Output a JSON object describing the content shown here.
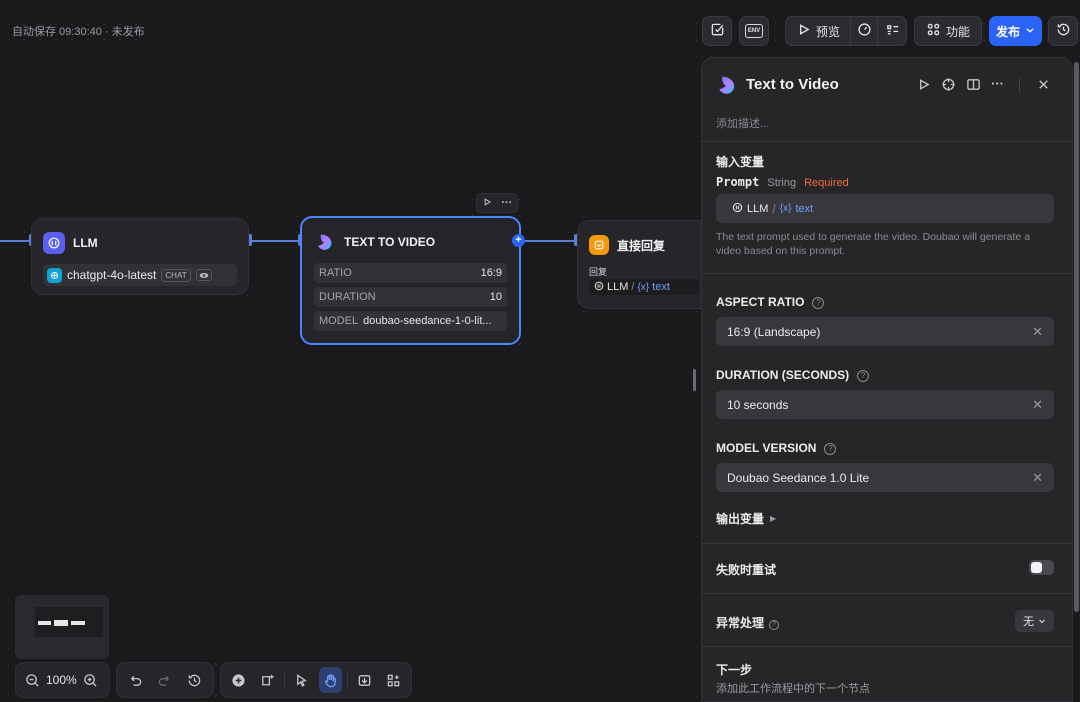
{
  "topbar": {
    "autosave": "自动保存 09:30:40 · 未发布",
    "env_label": "ENV",
    "preview_label": "预览",
    "features_label": "功能",
    "publish_label": "发布"
  },
  "nodes": {
    "llm": {
      "title": "LLM",
      "model": "chatgpt-4o-latest",
      "model_tag": "CHAT"
    },
    "t2v": {
      "title": "TEXT TO VIDEO",
      "rows": [
        {
          "key": "RATIO",
          "value": "16:9"
        },
        {
          "key": "DURATION",
          "value": "10"
        },
        {
          "key": "MODEL",
          "value": "doubao-seedance-1-0-lit..."
        }
      ]
    },
    "reply": {
      "title": "直接回复",
      "field_label": "回复",
      "ref_node": "LLM",
      "ref_var": "text"
    }
  },
  "bottombar": {
    "zoom": "100%"
  },
  "panel": {
    "title": "Text to Video",
    "desc_placeholder": "添加描述...",
    "input_vars_label": "输入变量",
    "prompt_label": "Prompt",
    "prompt_type": "String",
    "prompt_required": "Required",
    "prompt_ref_node": "LLM",
    "prompt_ref_var": "text",
    "prompt_help": "The text prompt used to generate the video. Doubao will generate a video based on this prompt.",
    "aspect_label": "ASPECT RATIO",
    "aspect_value": "16:9 (Landscape)",
    "duration_label": "DURATION (SECONDS)",
    "duration_value": "10 seconds",
    "model_label": "MODEL VERSION",
    "model_value": "Doubao Seedance 1.0 Lite",
    "output_vars_label": "输出变量",
    "retry_label": "失败时重试",
    "retry_enabled": false,
    "error_label": "异常处理",
    "error_value": "无",
    "next_label": "下一步",
    "next_desc": "添加此工作流程中的下一个节点"
  },
  "colors": {
    "accent": "#2a63f5",
    "selected_border": "#4a86ff",
    "required": "#f26b3a",
    "variable": "#6fa0ff"
  }
}
